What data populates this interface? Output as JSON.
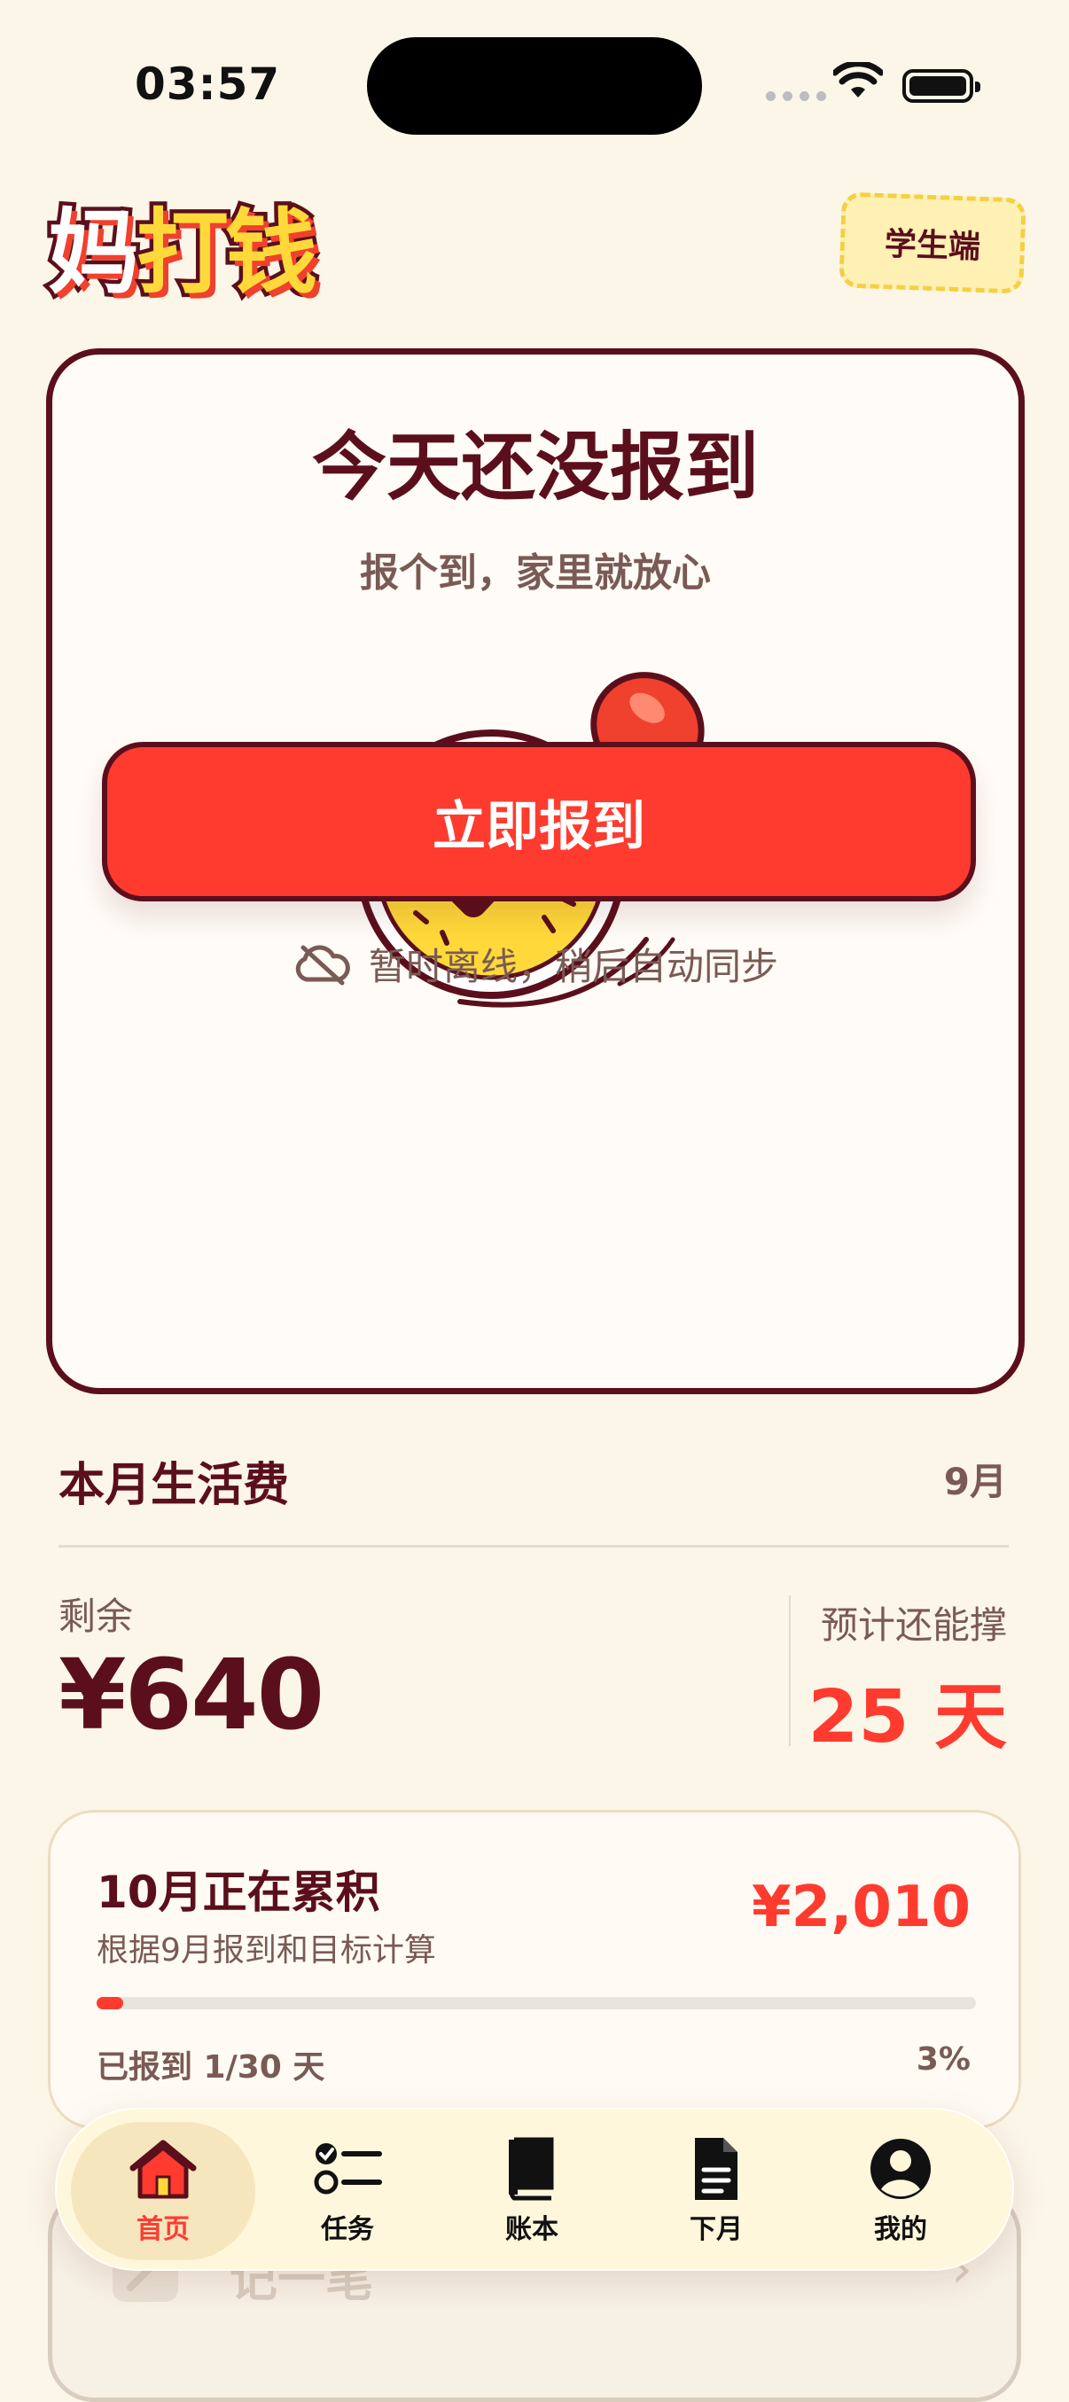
{
  "status_bar": {
    "time": "03:57"
  },
  "header": {
    "logo_char1": "妈",
    "logo_char2": "打钱",
    "role_badge": "学生端"
  },
  "checkin": {
    "title": "今天还没报到",
    "subtitle": "报个到，家里就放心",
    "button_label": "立即报到",
    "offline_text": "暂时离线，稍后自动同步"
  },
  "budget": {
    "title": "本月生活费",
    "month": "9月",
    "remaining_label": "剩余",
    "remaining_amount": "¥640",
    "forecast_label": "预计还能撑",
    "forecast_value": "25 天"
  },
  "accumulating": {
    "title": "10月正在累积",
    "subtitle": "根据9月报到和目标计算",
    "amount": "¥2,010",
    "progress_fraction": 0.03,
    "days_text": "已报到 1/30 天",
    "percent_text": "3%"
  },
  "next_card": {
    "label": "记一笔",
    "chevron": "›"
  },
  "tabbar": {
    "items": [
      {
        "label": "首页",
        "icon": "house-icon",
        "active": true
      },
      {
        "label": "任务",
        "icon": "checklist-icon",
        "active": false
      },
      {
        "label": "账本",
        "icon": "book-icon",
        "active": false
      },
      {
        "label": "下月",
        "icon": "document-icon",
        "active": false
      },
      {
        "label": "我的",
        "icon": "person-icon",
        "active": false
      }
    ]
  },
  "colors": {
    "background": "#FCF6E8",
    "primary_dark": "#5B0F1C",
    "accent_red": "#FF3B30",
    "accent_yellow": "#FFD93A"
  }
}
